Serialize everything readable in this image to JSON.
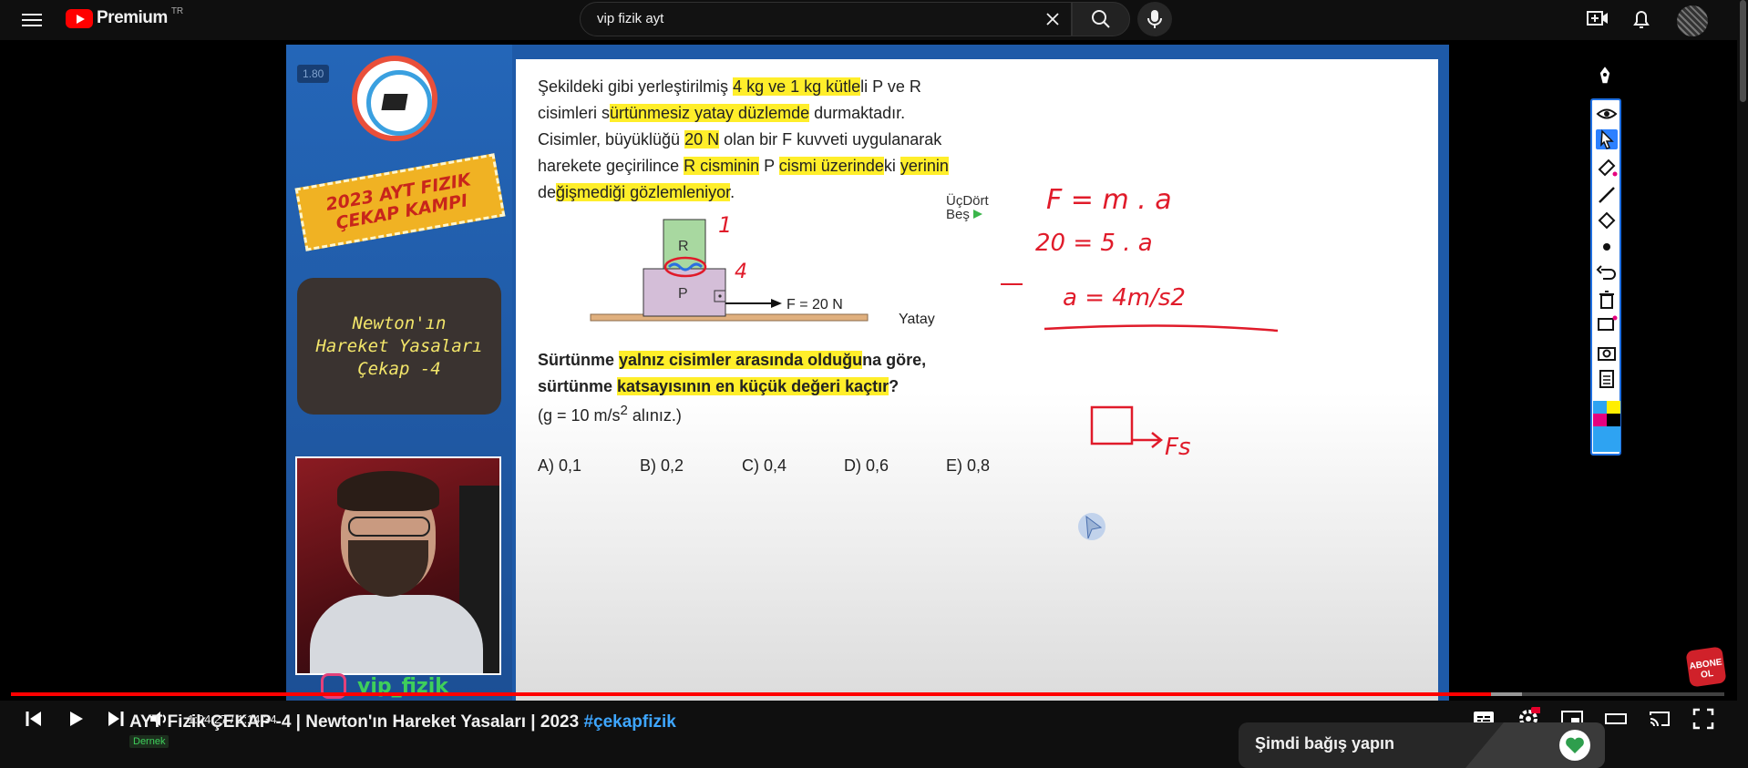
{
  "header": {
    "logo_text": "Premium",
    "logo_region": "TR",
    "search_value": "vip fizik ayt"
  },
  "video": {
    "speed_badge": "1.80",
    "camp_banner": "2023 AYT FIZIK\nÇEKAP KAMPI",
    "topic": "Newton'ın\nHareket Yasaları\nÇekap -4",
    "instagram": "vip_fizik",
    "brand": "ÜçDört\nBeş",
    "question": {
      "p1": "Şekildeki gibi yerleştirilmiş ",
      "h1": "4 kg ve 1 kg kütle",
      "p2": "li P ve R\ncisimleri s",
      "h2": "ürtünmesiz yatay düzlemde",
      "p3": " durmaktadır.\nCisimler, büyüklüğü ",
      "h3": "20 N",
      "p4": " olan bir F kuvveti uygulanarak\nharekete geçirilince ",
      "h4": "R cisminin",
      "p5": " P ",
      "h5": "cismi üzerinde",
      "p6": "ki ",
      "h6": "yerinin",
      "p7": "\nde",
      "h7": "ğişmediği gözlemleniyor",
      "p8": "."
    },
    "diagram": {
      "block_r": "R",
      "block_p": "P",
      "force": "F = 20 N",
      "surface": "Yatay"
    },
    "question2": {
      "a1": "Sürtünme ",
      "h1": "yalnız cisimler arasında olduğu",
      "a2": "na göre,",
      "b1": "sürtünme ",
      "h2": "katsayısının en küçük değeri kaçtır",
      "b2": "?"
    },
    "note": "(g = 10 m/s",
    "note_exp": "2",
    "note_end": " alınız.)",
    "options": [
      "A) 0,1",
      "B) 0,2",
      "C) 0,4",
      "D) 0,6",
      "E) 0,8"
    ],
    "handwriting": {
      "m1": "1",
      "m4": "4",
      "eq1": "F = m . a",
      "eq2": "20 = 5 . a",
      "eq3": "a = 4m/s2",
      "fs": "Fs"
    }
  },
  "controls": {
    "time": "1:04:27 / 1:14:34",
    "progress_fraction": 0.864,
    "buffer_fraction": 0.882,
    "subscribe_badge": "ABONE\nOL"
  },
  "below": {
    "title_main": "AYT Fizik ÇEKAP -4 | Newton'ın Hareket Yasaları | 2023 ",
    "title_hashtag": "#çekapfizik",
    "chip": "Dernek",
    "connect": "Şimdi bağış yapın"
  }
}
